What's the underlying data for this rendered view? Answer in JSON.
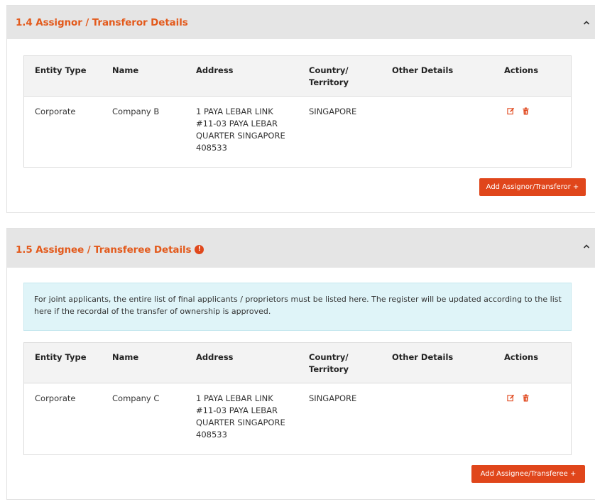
{
  "colors": {
    "accent": "#e35a1c",
    "button": "#e0461b",
    "header_bg": "#e5e5e5",
    "info_bg": "#dff4f8"
  },
  "assignor": {
    "title": "1.4 Assignor / Transferor Details",
    "collapse_icon": "chevron-up-icon",
    "columns": [
      "Entity Type",
      "Name",
      "Address",
      "Country/ Territory",
      "Other Details",
      "Actions"
    ],
    "rows": [
      {
        "entity_type": "Corporate",
        "name": "Company B",
        "address": "1 PAYA LEBAR LINK #11-03 PAYA LEBAR QUARTER SINGAPORE 408533",
        "country": "SINGAPORE",
        "other_details": "",
        "actions": [
          "edit-icon",
          "trash-icon"
        ]
      }
    ],
    "add_button": "Add Assignor/Transferor +"
  },
  "assignee": {
    "title": "1.5 Assignee / Transferee Details",
    "info_icon": "!",
    "collapse_icon": "chevron-up-icon",
    "notice": "For joint applicants, the entire list of final applicants / proprietors must be listed here. The register will be updated according to the list here if the recordal of the transfer of ownership is approved.",
    "columns": [
      "Entity Type",
      "Name",
      "Address",
      "Country/ Territory",
      "Other Details",
      "Actions"
    ],
    "rows": [
      {
        "entity_type": "Corporate",
        "name": "Company C",
        "address": "1 PAYA LEBAR LINK #11-03 PAYA LEBAR QUARTER SINGAPORE 408533",
        "country": "SINGAPORE",
        "other_details": "",
        "actions": [
          "edit-icon",
          "trash-icon"
        ]
      }
    ],
    "add_button": "Add Assignee/Transferee +"
  }
}
